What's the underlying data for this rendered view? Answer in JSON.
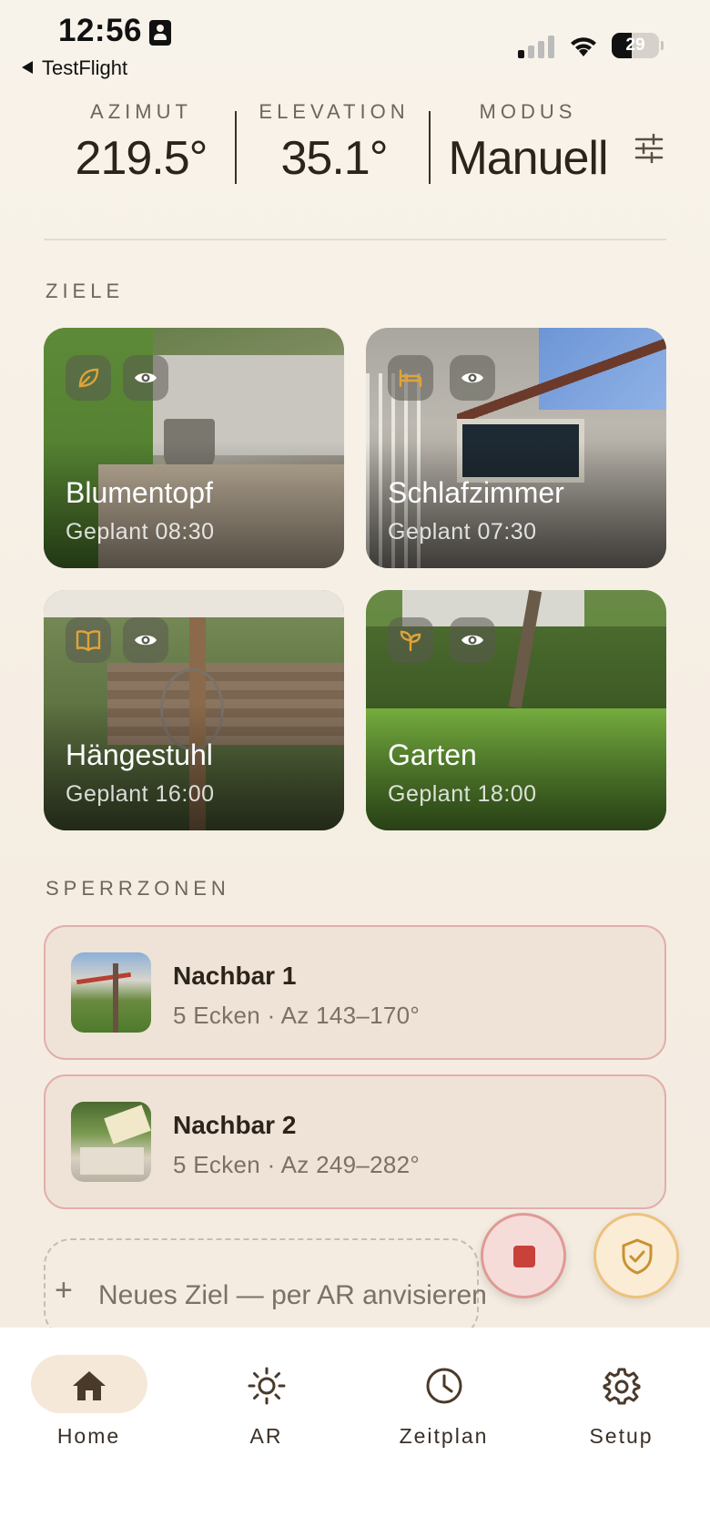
{
  "status_bar": {
    "time": "12:56",
    "back_app": "TestFlight",
    "battery": "29"
  },
  "header": {
    "stats": [
      {
        "label": "AZIMUT",
        "value": "219.5°"
      },
      {
        "label": "ELEVATION",
        "value": "35.1°"
      },
      {
        "label": "MODUS",
        "value": "Manuell"
      }
    ],
    "tune_icon": "tune-icon"
  },
  "targets": {
    "title": "ZIELE",
    "items": [
      {
        "name": "Blumentopf",
        "schedule": "Geplant 08:30",
        "icon": "leaf-icon"
      },
      {
        "name": "Schlafzimmer",
        "schedule": "Geplant 07:30",
        "icon": "bed-icon"
      },
      {
        "name": "Hängestuhl",
        "schedule": "Geplant 16:00",
        "icon": "book-icon"
      },
      {
        "name": "Garten",
        "schedule": "Geplant 18:00",
        "icon": "sprout-icon"
      }
    ]
  },
  "zones": {
    "title": "SPERRZONEN",
    "items": [
      {
        "name": "Nachbar 1",
        "detail": "5 Ecken · Az 143–170°"
      },
      {
        "name": "Nachbar 2",
        "detail": "5 Ecken · Az 249–282°"
      }
    ]
  },
  "add_target": {
    "plus": "+",
    "label": "Neues Ziel — per AR anvisieren"
  },
  "colors": {
    "accent": "#c9922f",
    "stop_red": "#c8423a",
    "nav_active": "#f6e8d8"
  },
  "nav": [
    {
      "label": "Home",
      "icon": "home-icon",
      "active": true
    },
    {
      "label": "AR",
      "icon": "sun-icon",
      "active": false
    },
    {
      "label": "Zeitplan",
      "icon": "clock-icon",
      "active": false
    },
    {
      "label": "Setup",
      "icon": "gear-icon",
      "active": false
    }
  ]
}
